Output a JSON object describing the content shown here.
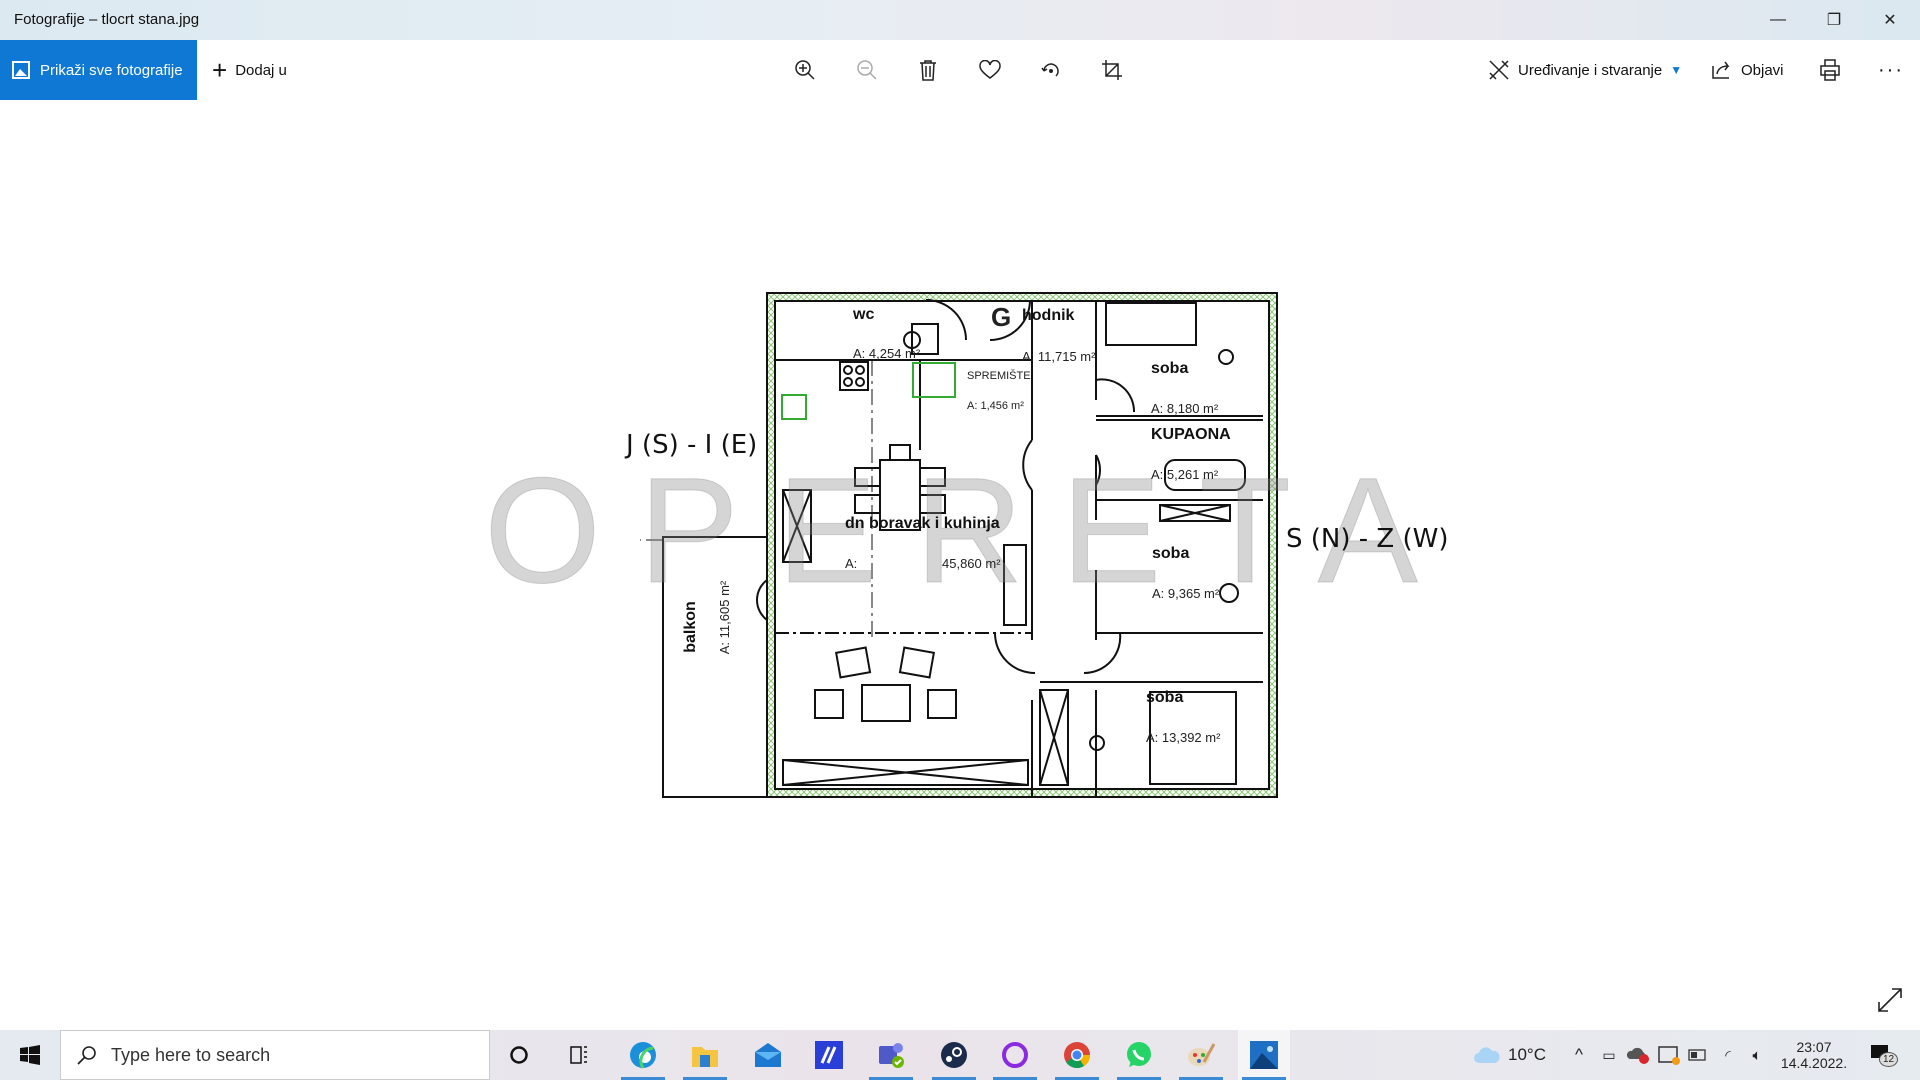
{
  "window": {
    "title": "Fotografije – tlocrt stana.jpg",
    "minimize_icon": "minimize-icon",
    "restore_icon": "restore-icon",
    "close_icon": "close-icon"
  },
  "toolbar": {
    "show_all": "Prikaži sve fotografije",
    "add_to": "Dodaj u",
    "edit_create": "Uređivanje i stvaranje",
    "share": "Objavi",
    "icons": [
      "zoom-in-icon",
      "zoom-out-icon",
      "delete-icon",
      "favorite-icon",
      "rotate-icon",
      "crop-icon",
      "print-icon",
      "more-icon"
    ]
  },
  "image": {
    "watermark": "OPERETA",
    "orientation_left": "J (S) - I (E)",
    "orientation_right": "S (N) - Z (W)",
    "rooms": [
      {
        "name": "wc",
        "area": "A: 4,254 m²"
      },
      {
        "name": "hodnik",
        "area": "A: 11,715 m²",
        "marker": "G"
      },
      {
        "name": "SPREMIŠTE",
        "area": "A: 1,456 m²"
      },
      {
        "name": "soba",
        "area": "A: 8,180 m²"
      },
      {
        "name": "KUPAONA",
        "area": "A: 5,261 m²"
      },
      {
        "name": "dn boravak i kuhinja",
        "area_prefix": "A:",
        "area": "45,860 m²"
      },
      {
        "name": "soba",
        "area": "A: 9,365 m²"
      },
      {
        "name": "soba",
        "area": "A: 13,392 m²"
      },
      {
        "name": "balkon",
        "area": "A: 11,605 m²"
      }
    ]
  },
  "taskbar": {
    "search_placeholder": "Type here to search",
    "apps": [
      "cortana",
      "task-view",
      "edge",
      "file-explorer",
      "mail",
      "affinity",
      "teams",
      "steam",
      "app-circle",
      "chrome",
      "whatsapp",
      "paint",
      "photos"
    ],
    "weather": "10°C",
    "time": "23:07",
    "date": "14.4.2022.",
    "notifications": "12"
  },
  "colors": {
    "accent": "#0f78d4",
    "wall_hatch": "#9fd08a"
  }
}
